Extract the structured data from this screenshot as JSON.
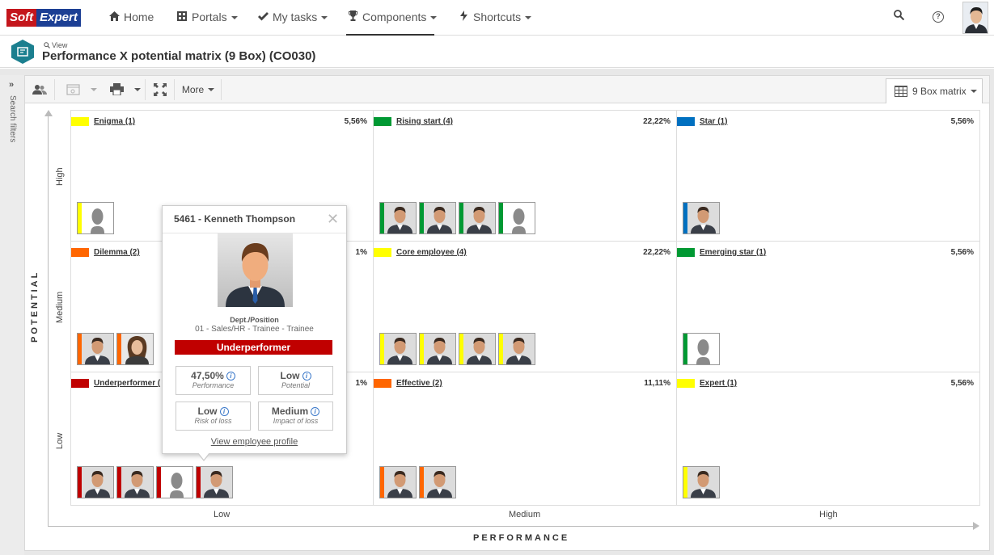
{
  "nav": {
    "logo_left": "Soft",
    "logo_right": "Expert",
    "items": [
      {
        "label": "Home",
        "icon": "home-icon"
      },
      {
        "label": "Portals",
        "icon": "portals-icon"
      },
      {
        "label": "My tasks",
        "icon": "check-icon"
      },
      {
        "label": "Components",
        "icon": "trophy-icon"
      },
      {
        "label": "Shortcuts",
        "icon": "bolt-icon"
      }
    ],
    "active": "Components",
    "help_glyph": "?"
  },
  "header": {
    "view_label": "View",
    "title": "Performance X potential matrix (9 Box) (CO030)"
  },
  "side": {
    "filters_label": "Search filters"
  },
  "toolbar": {
    "more_label": "More",
    "view_tab": "9 Box matrix"
  },
  "axes": {
    "y_label": "POTENTIAL",
    "x_label": "PERFORMANCE",
    "rows": [
      "High",
      "Medium",
      "Low"
    ],
    "cols": [
      "Low",
      "Medium",
      "High"
    ]
  },
  "colors": {
    "yellow": "#ffff00",
    "green": "#009933",
    "blue": "#0070c0",
    "orange": "#ff6600",
    "red": "#c00000"
  },
  "cells": [
    {
      "name": "Enigma (1)",
      "pct": "5,56%",
      "color": "#ffff00",
      "photos": [
        {
          "bar": "#ffff00",
          "type": "silhouette"
        }
      ]
    },
    {
      "name": "Rising start (4)",
      "pct": "22,22%",
      "color": "#009933",
      "photos": [
        {
          "bar": "#009933",
          "type": "man"
        },
        {
          "bar": "#009933",
          "type": "man"
        },
        {
          "bar": "#009933",
          "type": "man"
        },
        {
          "bar": "#009933",
          "type": "silhouette"
        }
      ]
    },
    {
      "name": "Star (1)",
      "pct": "5,56%",
      "color": "#0070c0",
      "photos": [
        {
          "bar": "#0070c0",
          "type": "man"
        }
      ]
    },
    {
      "name": "Dilemma (2)",
      "pct": "1%",
      "color": "#ff6600",
      "photos": [
        {
          "bar": "#ff6600",
          "type": "man"
        },
        {
          "bar": "#ff6600",
          "type": "woman"
        }
      ]
    },
    {
      "name": "Core employee (4)",
      "pct": "22,22%",
      "color": "#ffff00",
      "photos": [
        {
          "bar": "#ffff00",
          "type": "man"
        },
        {
          "bar": "#ffff00",
          "type": "man"
        },
        {
          "bar": "#ffff00",
          "type": "man"
        },
        {
          "bar": "#ffff00",
          "type": "man"
        }
      ]
    },
    {
      "name": "Emerging star (1)",
      "pct": "5,56%",
      "color": "#009933",
      "photos": [
        {
          "bar": "#009933",
          "type": "silhouette"
        }
      ]
    },
    {
      "name": "Underperformer (",
      "pct": "1%",
      "color": "#c00000",
      "photos": [
        {
          "bar": "#c00000",
          "type": "man"
        },
        {
          "bar": "#c00000",
          "type": "man"
        },
        {
          "bar": "#c00000",
          "type": "silhouette"
        },
        {
          "bar": "#c00000",
          "type": "man"
        }
      ]
    },
    {
      "name": "Effective (2)",
      "pct": "11,11%",
      "color": "#ff6600",
      "photos": [
        {
          "bar": "#ff6600",
          "type": "man"
        },
        {
          "bar": "#ff6600",
          "type": "man"
        }
      ]
    },
    {
      "name": "Expert (1)",
      "pct": "5,56%",
      "color": "#ffff00",
      "photos": [
        {
          "bar": "#ffff00",
          "type": "man"
        }
      ]
    }
  ],
  "popup": {
    "title": "5461 - Kenneth Thompson",
    "close_glyph": "✕",
    "dept_label": "Dept./Position",
    "dept_value": "01 - Sales/HR - Trainee - Trainee",
    "badge": "Underperformer",
    "metrics": [
      {
        "value": "47,50%",
        "label": "Performance"
      },
      {
        "value": "Low",
        "label": "Potential"
      },
      {
        "value": "Low",
        "label": "Risk of loss"
      },
      {
        "value": "Medium",
        "label": "Impact of loss"
      }
    ],
    "info_glyph": "i",
    "link": "View employee profile"
  }
}
